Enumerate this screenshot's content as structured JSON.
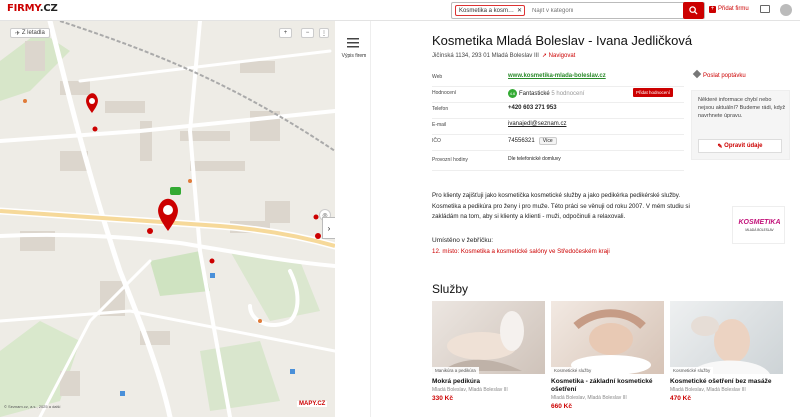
{
  "header": {
    "logo_main": "FIRMY",
    "logo_tld": ".CZ",
    "search_chip": "Kosmetika a kosm…",
    "search_placeholder": "Najít v kategorii",
    "add_firm": "Přidat firmu"
  },
  "map": {
    "back_label": "Z letadla",
    "zoom_in": "+",
    "zoom_out": "−",
    "attribution": "© Seznam.cz, a.s., 2025 a další",
    "logo": "MAPY.CZ",
    "rating_pin": "4.6"
  },
  "sidebar": {
    "layers_label": "Výpis firem"
  },
  "firm": {
    "title": "Kosmetika Mladá Boleslav - Ivana Jedličková",
    "address": "Jičínská 1134, 293 01 Mladá Boleslav III",
    "navigate": "Navigovat",
    "rows": {
      "web_label": "Web",
      "web_value": "www.kosmetika-mlada-boleslav.cz",
      "rating_label": "Hodnocení",
      "rating_score": "4.6",
      "rating_text": "Fantastické",
      "rating_count": "5 hodnocení",
      "rating_button": "Přidat hodnocení",
      "phone_label": "Telefon",
      "phone_value": "+420 603 271 953",
      "email_label": "E-mail",
      "email_value": "ivanajedl@seznam.cz",
      "ico_label": "IČO",
      "ico_value": "74556321",
      "ico_more": "Více",
      "hours_label": "Provozní hodiny",
      "hours_value": "Dle telefonické domluvy"
    },
    "poptavka": "Poslat poptávku",
    "info_text": "Některé informace chybí nebo nejsou aktuální? Budeme rádi, když navrhnete úpravu.",
    "info_button": "Opravit údaje",
    "description": "Pro klienty zajišťuji jako kosmetička kosmetické služby a jako pedikérka pedikérské služby. Kosmetika a pedikúra pro ženy i pro muže. Této práci se věnuji od roku 2007. V mém studiu si zakládám na tom, aby si klienty a klienti - muži, odpočinuli a relaxovali.",
    "ladder_title": "Umístěno v žebříčku:",
    "ladder_link": "12. místo: Kosmetika a kosmetické salóny ve Středočeském kraji",
    "logo_text": "KOSMETIKA",
    "logo_sub": "MLADÁ BOLESLAV"
  },
  "services": {
    "title": "Služby",
    "items": [
      {
        "category": "Manikúra a pedikúra",
        "name": "Mokrá pedikúra",
        "location": "Mladá Boleslav, Mladá Boleslav III",
        "price": "330 Kč"
      },
      {
        "category": "Kosmetické služby",
        "name": "Kosmetika - základní kosmetické ošetření",
        "location": "Mladá Boleslav, Mladá Boleslav III",
        "price": "660 Kč"
      },
      {
        "category": "Kosmetické služby",
        "name": "Kosmetické ošetření bez masáže",
        "location": "Mladá Boleslav, Mladá Boleslav III",
        "price": "470 Kč"
      }
    ]
  },
  "colors": {
    "accent": "#cc0000",
    "link_green": "#2a8a2a",
    "rating_green": "#33aa33"
  }
}
